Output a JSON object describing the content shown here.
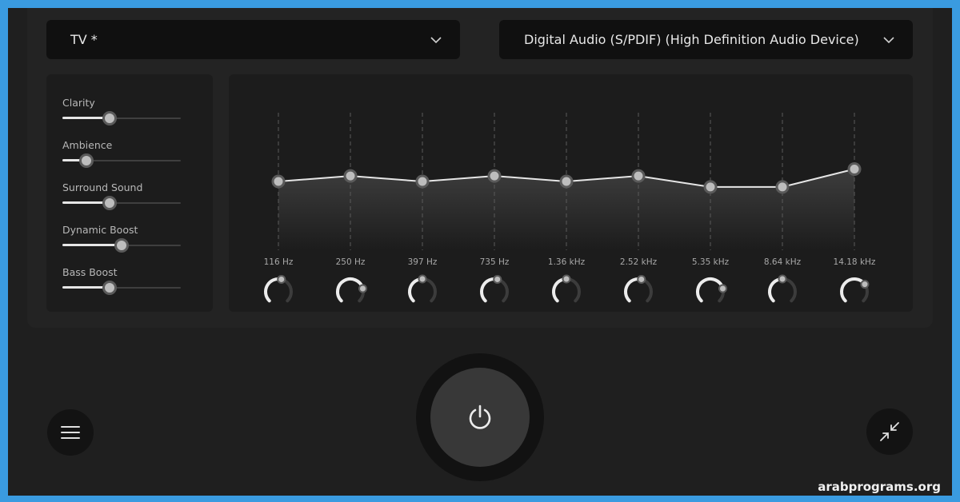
{
  "output_device": {
    "label": "TV *",
    "icon": "chevron-down-icon"
  },
  "audio_device": {
    "label": "Digital Audio (S/PDIF) (High Definition Audio Device)",
    "icon": "chevron-down-icon"
  },
  "effects": [
    {
      "label": "Clarity",
      "value": 0.4
    },
    {
      "label": "Ambience",
      "value": 0.2
    },
    {
      "label": "Surround Sound",
      "value": 0.4
    },
    {
      "label": "Dynamic Boost",
      "value": 0.5
    },
    {
      "label": "Bass Boost",
      "value": 0.4
    }
  ],
  "equalizer": {
    "bands": [
      {
        "freq": "116 Hz",
        "gain": 0.5,
        "knob": 0.55
      },
      {
        "freq": "250 Hz",
        "gain": 0.54,
        "knob": 0.78
      },
      {
        "freq": "397 Hz",
        "gain": 0.5,
        "knob": 0.5
      },
      {
        "freq": "735 Hz",
        "gain": 0.54,
        "knob": 0.55
      },
      {
        "freq": "1.36 kHz",
        "gain": 0.5,
        "knob": 0.5
      },
      {
        "freq": "2.52 kHz",
        "gain": 0.54,
        "knob": 0.55
      },
      {
        "freq": "5.35 kHz",
        "gain": 0.46,
        "knob": 0.78
      },
      {
        "freq": "8.64 kHz",
        "gain": 0.46,
        "knob": 0.5
      },
      {
        "freq": "14.18 kHz",
        "gain": 0.59,
        "knob": 0.7
      }
    ]
  },
  "controls": {
    "menu_icon": "hamburger-menu-icon",
    "power_icon": "power-icon",
    "shrink_icon": "minimize-arrows-icon"
  },
  "watermark": "arabprograms.org",
  "colors": {
    "accent": "#e6e6e6",
    "background": "#1f1f1f",
    "frame": "#3a9be0"
  }
}
